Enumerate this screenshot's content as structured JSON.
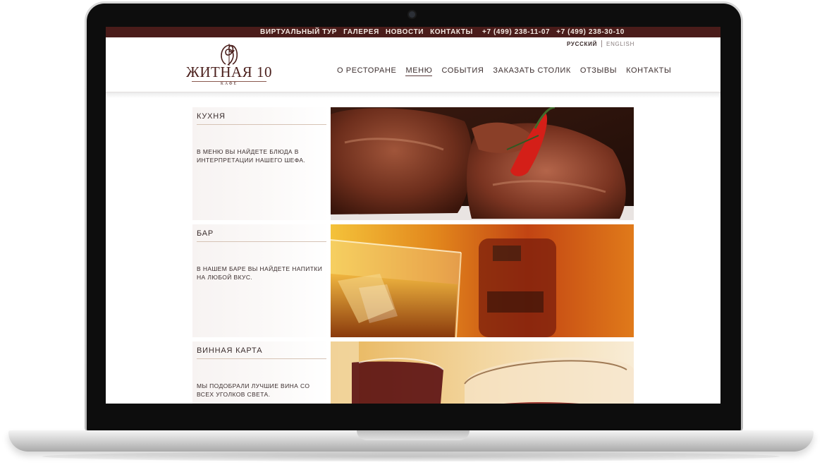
{
  "topbar": {
    "links": [
      "ВИРТУАЛЬНЫЙ ТУР",
      "ГАЛЕРЕЯ",
      "НОВОСТИ",
      "КОНТАКТЫ"
    ],
    "phones": [
      "+7 (499) 238-11-07",
      "+7 (499) 238-30-10"
    ]
  },
  "lang": {
    "ru": "РУССКИЙ",
    "en": "ENGLISH"
  },
  "logo": {
    "name": "ЖИТНАЯ 10",
    "sub": "КАФЕ"
  },
  "nav": {
    "items": [
      "О РЕСТОРАНЕ",
      "МЕНЮ",
      "СОБЫТИЯ",
      "ЗАКАЗАТЬ СТОЛИК",
      "ОТЗЫВЫ",
      "КОНТАКТЫ"
    ],
    "active": "МЕНЮ"
  },
  "sections": [
    {
      "title": "КУХНЯ",
      "text": "В МЕНЮ ВЫ НАЙДЕТЕ БЛЮДА В ИНТЕРПРЕТАЦИИ НАШЕГО ШЕФА.",
      "photo": "grilled-steak-photo"
    },
    {
      "title": "БАР",
      "text": "В НАШЕМ БАРЕ ВЫ НАЙДЕТЕ НАПИТКИ НА ЛЮБОЙ ВКУС.",
      "photo": "whisky-glass-photo"
    },
    {
      "title": "ВИННАЯ КАРТА",
      "text": "МЫ ПОДОБРАЛИ ЛУЧШИЕ ВИНА СО ВСЕХ УГОЛКОВ СВЕТА.",
      "photo": "wine-glass-photo"
    }
  ],
  "colors": {
    "brand": "#4a1c1a",
    "text": "#3a2d2d"
  }
}
